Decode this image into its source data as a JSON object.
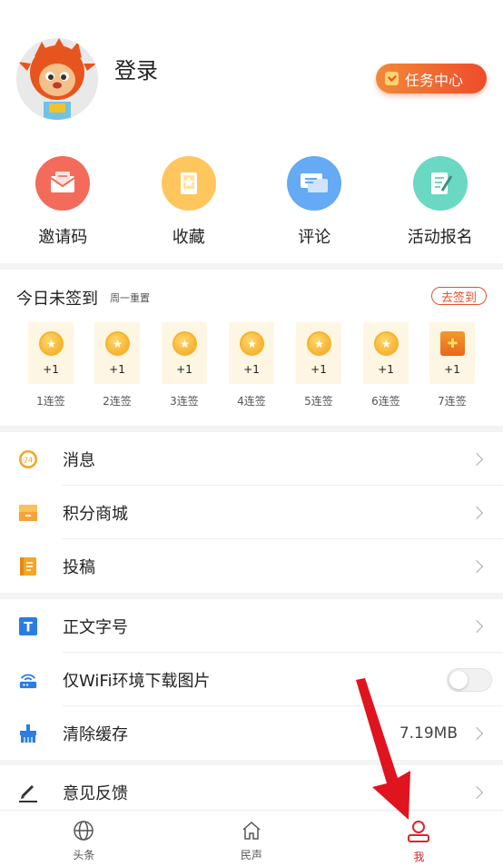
{
  "profile": {
    "login_text": "登录",
    "task_button": "任务中心"
  },
  "quick_actions": [
    {
      "label": "邀请码",
      "icon": "mail-icon",
      "color": "#f26b5b"
    },
    {
      "label": "收藏",
      "icon": "bookmark-icon",
      "color": "#ffc65e"
    },
    {
      "label": "评论",
      "icon": "comment-icon",
      "color": "#64aaf4"
    },
    {
      "label": "活动报名",
      "icon": "form-icon",
      "color": "#6ad8c3"
    }
  ],
  "checkin": {
    "title": "今日未签到",
    "subtitle": "周一重置",
    "button": "去签到",
    "days": [
      {
        "reward": "+1",
        "label": "1连签"
      },
      {
        "reward": "+1",
        "label": "2连签"
      },
      {
        "reward": "+1",
        "label": "3连签"
      },
      {
        "reward": "+1",
        "label": "4连签"
      },
      {
        "reward": "+1",
        "label": "5连签"
      },
      {
        "reward": "+1",
        "label": "6连签"
      },
      {
        "reward": "+1",
        "label": "7连签"
      }
    ]
  },
  "menu_group1": [
    {
      "label": "消息",
      "icon": "message-clock-icon"
    },
    {
      "label": "积分商城",
      "icon": "store-icon"
    },
    {
      "label": "投稿",
      "icon": "document-icon"
    }
  ],
  "menu_group2": [
    {
      "label": "正文字号",
      "icon": "font-size-icon"
    },
    {
      "label": "仅WiFi环境下载图片",
      "icon": "wifi-router-icon",
      "toggle": false
    },
    {
      "label": "清除缓存",
      "icon": "broom-icon",
      "value": "7.19MB"
    }
  ],
  "menu_group3": [
    {
      "label": "意见反馈",
      "icon": "pencil-icon"
    }
  ],
  "bottom_nav": [
    {
      "label": "头条",
      "icon": "globe-icon"
    },
    {
      "label": "民声",
      "icon": "home-icon"
    },
    {
      "label": "我",
      "icon": "user-icon",
      "active": true
    }
  ],
  "colors": {
    "accent": "#e6512e",
    "active_nav": "#d7282b",
    "arrow": "#e0141e"
  }
}
